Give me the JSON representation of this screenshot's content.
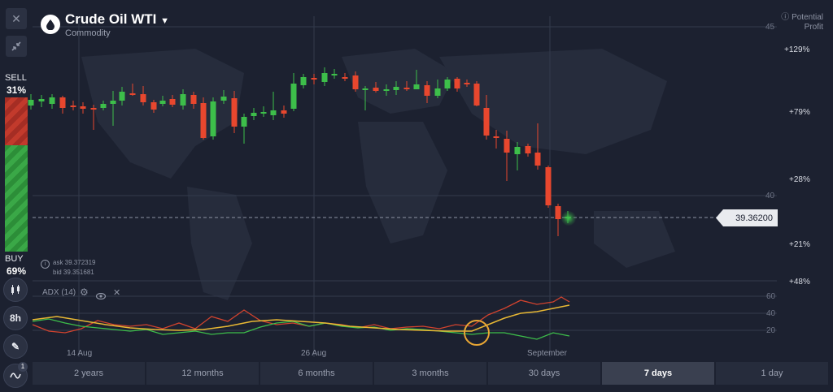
{
  "header": {
    "title": "Crude Oil WTI",
    "subtitle": "Commodity"
  },
  "toolbar": {
    "close_icon": "close-icon",
    "collapse_icon": "collapse-arrows-icon",
    "chart_type_icon": "candlestick-icon",
    "timeframe": "8h",
    "draw_icon": "pencil-icon",
    "indicators_badge": "1"
  },
  "sentiment": {
    "sell_label": "SELL",
    "sell_pct": "31%",
    "buy_label": "BUY",
    "buy_pct": "69%",
    "sell_fraction": 0.31,
    "buy_fraction": 0.69
  },
  "potential_profit": {
    "label_line1": "Potential",
    "label_line2": "Profit",
    "levels": [
      "+129%",
      "+79%",
      "+28%",
      "+21%",
      "+48%"
    ]
  },
  "price_axis": [
    "45",
    "40"
  ],
  "current_price": "39.36200",
  "quote": {
    "ask": "ask 39.372319",
    "bid": "bid 39.351681"
  },
  "indicator": {
    "name": "ADX (14)",
    "axis": [
      "60",
      "40",
      "20"
    ]
  },
  "dates": [
    "14 Aug",
    "26 Aug",
    "September"
  ],
  "timeframes": [
    {
      "label": "2 years",
      "active": false
    },
    {
      "label": "12 months",
      "active": false
    },
    {
      "label": "6 months",
      "active": false
    },
    {
      "label": "3 months",
      "active": false
    },
    {
      "label": "30 days",
      "active": false
    },
    {
      "label": "7 days",
      "active": true
    },
    {
      "label": "1 day",
      "active": false
    }
  ],
  "colors": {
    "up": "#3dbe4a",
    "down": "#e8472e",
    "background": "#1c2130",
    "adx_yellow": "#e8b834"
  }
}
